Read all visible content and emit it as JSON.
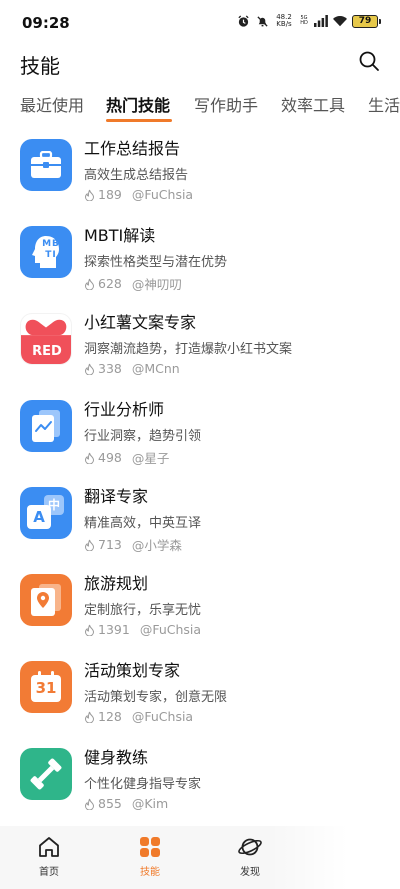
{
  "status_bar": {
    "time": "09:28",
    "net_speed_value": "48.2",
    "net_speed_unit": "KB/s",
    "net_type": "5G HD",
    "battery": "79"
  },
  "header": {
    "title": "技能"
  },
  "tabs": [
    {
      "label": "最近使用"
    },
    {
      "label": "热门技能"
    },
    {
      "label": "写作助手"
    },
    {
      "label": "效率工具"
    },
    {
      "label": "生活"
    }
  ],
  "skills": [
    {
      "title": "工作总结报告",
      "desc": "高效生成总结报告",
      "count": "189",
      "author": "@FuChsia",
      "icon": "briefcase-icon",
      "color": "#3b8df2"
    },
    {
      "title": "MBTI解读",
      "desc": "探索性格类型与潜在优势",
      "count": "628",
      "author": "@神叨叨",
      "icon": "mbti-head-icon",
      "color": "#3b8df2",
      "icon_text": "MBTI"
    },
    {
      "title": "小红薯文案专家",
      "desc": "洞察潮流趋势，打造爆款小红书文案",
      "count": "338",
      "author": "@MCnn",
      "icon": "red-bag-icon",
      "color": "#f0505a",
      "icon_text": "RED"
    },
    {
      "title": "行业分析师",
      "desc": "行业洞察，趋势引领",
      "count": "498",
      "author": "@星子",
      "icon": "trend-document-icon",
      "color": "#3b8df2"
    },
    {
      "title": "翻译专家",
      "desc": "精准高效，中英互译",
      "count": "713",
      "author": "@小学森",
      "icon": "translate-icon",
      "color": "#3b8df2",
      "icon_text_a": "A",
      "icon_text_b": "中"
    },
    {
      "title": "旅游规划",
      "desc": "定制旅行，乐享无忧",
      "count": "1391",
      "author": "@FuChsia",
      "icon": "map-pin-icon",
      "color": "#f27b35"
    },
    {
      "title": "活动策划专家",
      "desc": "活动策划专家，创意无限",
      "count": "128",
      "author": "@FuChsia",
      "icon": "calendar-icon",
      "color": "#f27b35",
      "icon_text": "31"
    },
    {
      "title": "健身教练",
      "desc": "个性化健身指导专家",
      "count": "855",
      "author": "@Kim",
      "icon": "dumbbell-icon",
      "color": "#2fb58a"
    }
  ],
  "bottom_nav": [
    {
      "label": "首页",
      "icon": "home-icon"
    },
    {
      "label": "技能",
      "icon": "grid-icon",
      "active": true
    },
    {
      "label": "发现",
      "icon": "planet-icon"
    }
  ],
  "colors": {
    "accent": "#f07a2a"
  }
}
